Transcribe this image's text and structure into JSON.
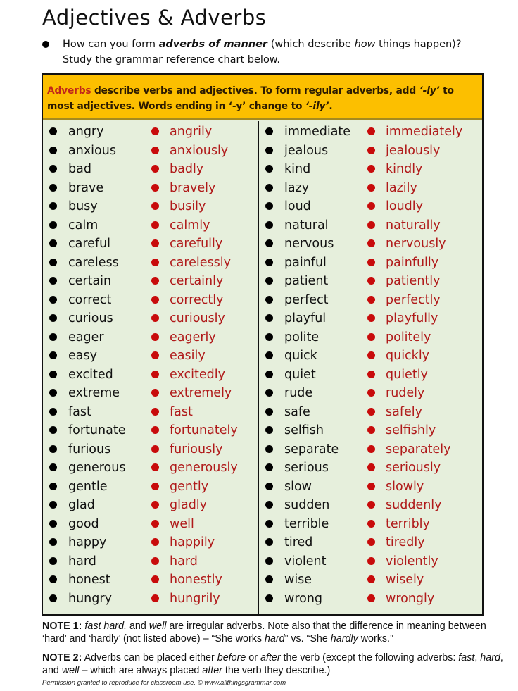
{
  "title": "Adjectives & Adverbs",
  "intro": {
    "bullet_icon": "black-dot",
    "line_part1": "How can you form ",
    "line_bold_italic": "adverbs of manner",
    "line_part2": " (which describe ",
    "line_italic": "how",
    "line_part3": " things happen)?",
    "line2": "Study the grammar reference chart below."
  },
  "header": {
    "highlight": "Adverbs",
    "text1": " describe verbs and adjectives. To form regular adverbs, add ",
    "italic1": "‘-ly’",
    "text2": " to most adjectives. Words ending in ‘-y’ change to ",
    "italic2": "‘-ily’",
    "text3": ".",
    "background_color": "#fcbf00",
    "highlight_color": "#c0261b"
  },
  "colors": {
    "table_bg": "#e6efdc",
    "adjective_color": "#111111",
    "adverb_color": "#b01a1a",
    "adverb_bullet": "#c80b0b"
  },
  "left_column": [
    {
      "adjective": "angry",
      "adverb": "angrily"
    },
    {
      "adjective": "anxious",
      "adverb": "anxiously"
    },
    {
      "adjective": "bad",
      "adverb": "badly"
    },
    {
      "adjective": "brave",
      "adverb": "bravely"
    },
    {
      "adjective": "busy",
      "adverb": "busily"
    },
    {
      "adjective": "calm",
      "adverb": "calmly"
    },
    {
      "adjective": "careful",
      "adverb": "carefully"
    },
    {
      "adjective": "careless",
      "adverb": "carelessly"
    },
    {
      "adjective": "certain",
      "adverb": "certainly"
    },
    {
      "adjective": "correct",
      "adverb": "correctly"
    },
    {
      "adjective": "curious",
      "adverb": "curiously"
    },
    {
      "adjective": "eager",
      "adverb": "eagerly"
    },
    {
      "adjective": "easy",
      "adverb": "easily"
    },
    {
      "adjective": "excited",
      "adverb": "excitedly"
    },
    {
      "adjective": "extreme",
      "adverb": "extremely"
    },
    {
      "adjective": "fast",
      "adverb": "fast"
    },
    {
      "adjective": "fortunate",
      "adverb": "fortunately"
    },
    {
      "adjective": "furious",
      "adverb": "furiously"
    },
    {
      "adjective": "generous",
      "adverb": "generously"
    },
    {
      "adjective": "gentle",
      "adverb": "gently"
    },
    {
      "adjective": "glad",
      "adverb": "gladly"
    },
    {
      "adjective": "good",
      "adverb": "well"
    },
    {
      "adjective": "happy",
      "adverb": "happily"
    },
    {
      "adjective": "hard",
      "adverb": "hard"
    },
    {
      "adjective": "honest",
      "adverb": "honestly"
    },
    {
      "adjective": "hungry",
      "adverb": "hungrily"
    }
  ],
  "right_column": [
    {
      "adjective": "immediate",
      "adverb": "immediately"
    },
    {
      "adjective": "jealous",
      "adverb": "jealously"
    },
    {
      "adjective": "kind",
      "adverb": "kindly"
    },
    {
      "adjective": "lazy",
      "adverb": "lazily"
    },
    {
      "adjective": "loud",
      "adverb": "loudly"
    },
    {
      "adjective": "natural",
      "adverb": "naturally"
    },
    {
      "adjective": "nervous",
      "adverb": "nervously"
    },
    {
      "adjective": "painful",
      "adverb": "painfully"
    },
    {
      "adjective": "patient",
      "adverb": "patiently"
    },
    {
      "adjective": "perfect",
      "adverb": "perfectly"
    },
    {
      "adjective": "playful",
      "adverb": "playfully"
    },
    {
      "adjective": "polite",
      "adverb": "politely"
    },
    {
      "adjective": "quick",
      "adverb": "quickly"
    },
    {
      "adjective": "quiet",
      "adverb": "quietly"
    },
    {
      "adjective": "rude",
      "adverb": "rudely"
    },
    {
      "adjective": "safe",
      "adverb": "safely"
    },
    {
      "adjective": "selfish",
      "adverb": "selfishly"
    },
    {
      "adjective": "separate",
      "adverb": "separately"
    },
    {
      "adjective": "serious",
      "adverb": "seriously"
    },
    {
      "adjective": "slow",
      "adverb": "slowly"
    },
    {
      "adjective": "sudden",
      "adverb": "suddenly"
    },
    {
      "adjective": "terrible",
      "adverb": "terribly"
    },
    {
      "adjective": "tired",
      "adverb": "tiredly"
    },
    {
      "adjective": "violent",
      "adverb": "violently"
    },
    {
      "adjective": "wise",
      "adverb": "wisely"
    },
    {
      "adjective": "wrong",
      "adverb": "wrongly"
    }
  ],
  "notes": {
    "note1": {
      "label": "NOTE 1:",
      "i1": "fast hard,",
      "t1": " and ",
      "i2": "well",
      "t2": " are irregular adverbs.  Note also that the difference in meaning between ‘hard’ and ‘hardly’ (not listed above) – “She works ",
      "i3": "hard",
      "t3": "” vs. “She ",
      "i4": "hardly",
      "t4": " works.”"
    },
    "note2": {
      "label": "NOTE 2:",
      "t1": " Adverbs can be placed either ",
      "i1": "before",
      "t2": " or ",
      "i2": "after",
      "t3": " the verb (except the following adverbs: ",
      "i3": "fast",
      "t4": ", ",
      "i4": "hard",
      "t5": ", and ",
      "i5": "well",
      "t6": " – which are always placed ",
      "i6": "after",
      "t7": " the verb they describe.)"
    }
  },
  "permission": "Permission granted to reproduce for classroom use.  © www.allthingsgrammar.com"
}
